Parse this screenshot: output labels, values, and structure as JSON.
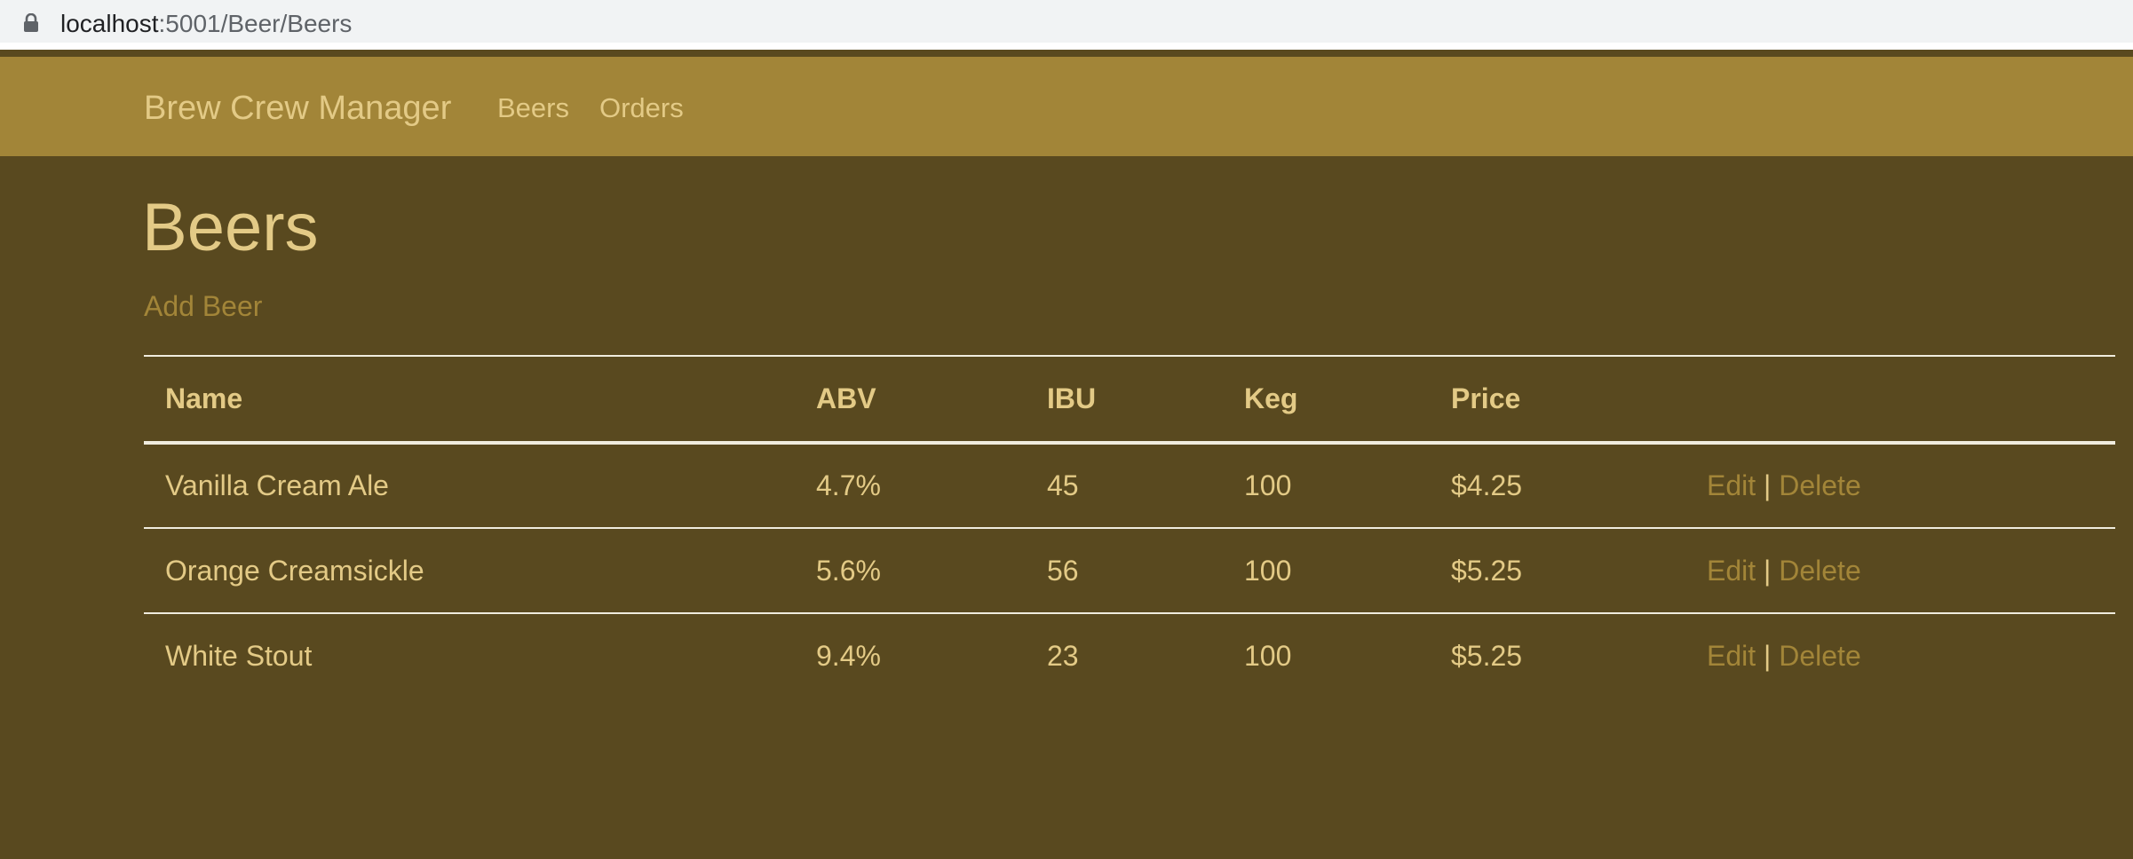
{
  "browser": {
    "url_host": "localhost",
    "url_path": ":5001/Beer/Beers"
  },
  "navbar": {
    "brand": "Brew Crew Manager",
    "links": [
      "Beers",
      "Orders"
    ]
  },
  "main": {
    "title": "Beers",
    "add_link": "Add Beer",
    "table": {
      "headers": [
        "Name",
        "ABV",
        "IBU",
        "Keg",
        "Price",
        ""
      ],
      "rows": [
        {
          "name": "Vanilla Cream Ale",
          "abv": "4.7%",
          "ibu": "45",
          "keg": "100",
          "price": "$4.25",
          "edit": "Edit",
          "sep": "|",
          "delete": "Delete"
        },
        {
          "name": "Orange Creamsickle",
          "abv": "5.6%",
          "ibu": "56",
          "keg": "100",
          "price": "$5.25",
          "edit": "Edit",
          "sep": "|",
          "delete": "Delete"
        },
        {
          "name": "White Stout",
          "abv": "9.4%",
          "ibu": "23",
          "keg": "100",
          "price": "$5.25",
          "edit": "Edit",
          "sep": "|",
          "delete": "Delete"
        }
      ]
    }
  },
  "colors": {
    "background": "#59491f",
    "navbar": "#a28538",
    "text": "#e3ca86",
    "link": "#a28538"
  }
}
